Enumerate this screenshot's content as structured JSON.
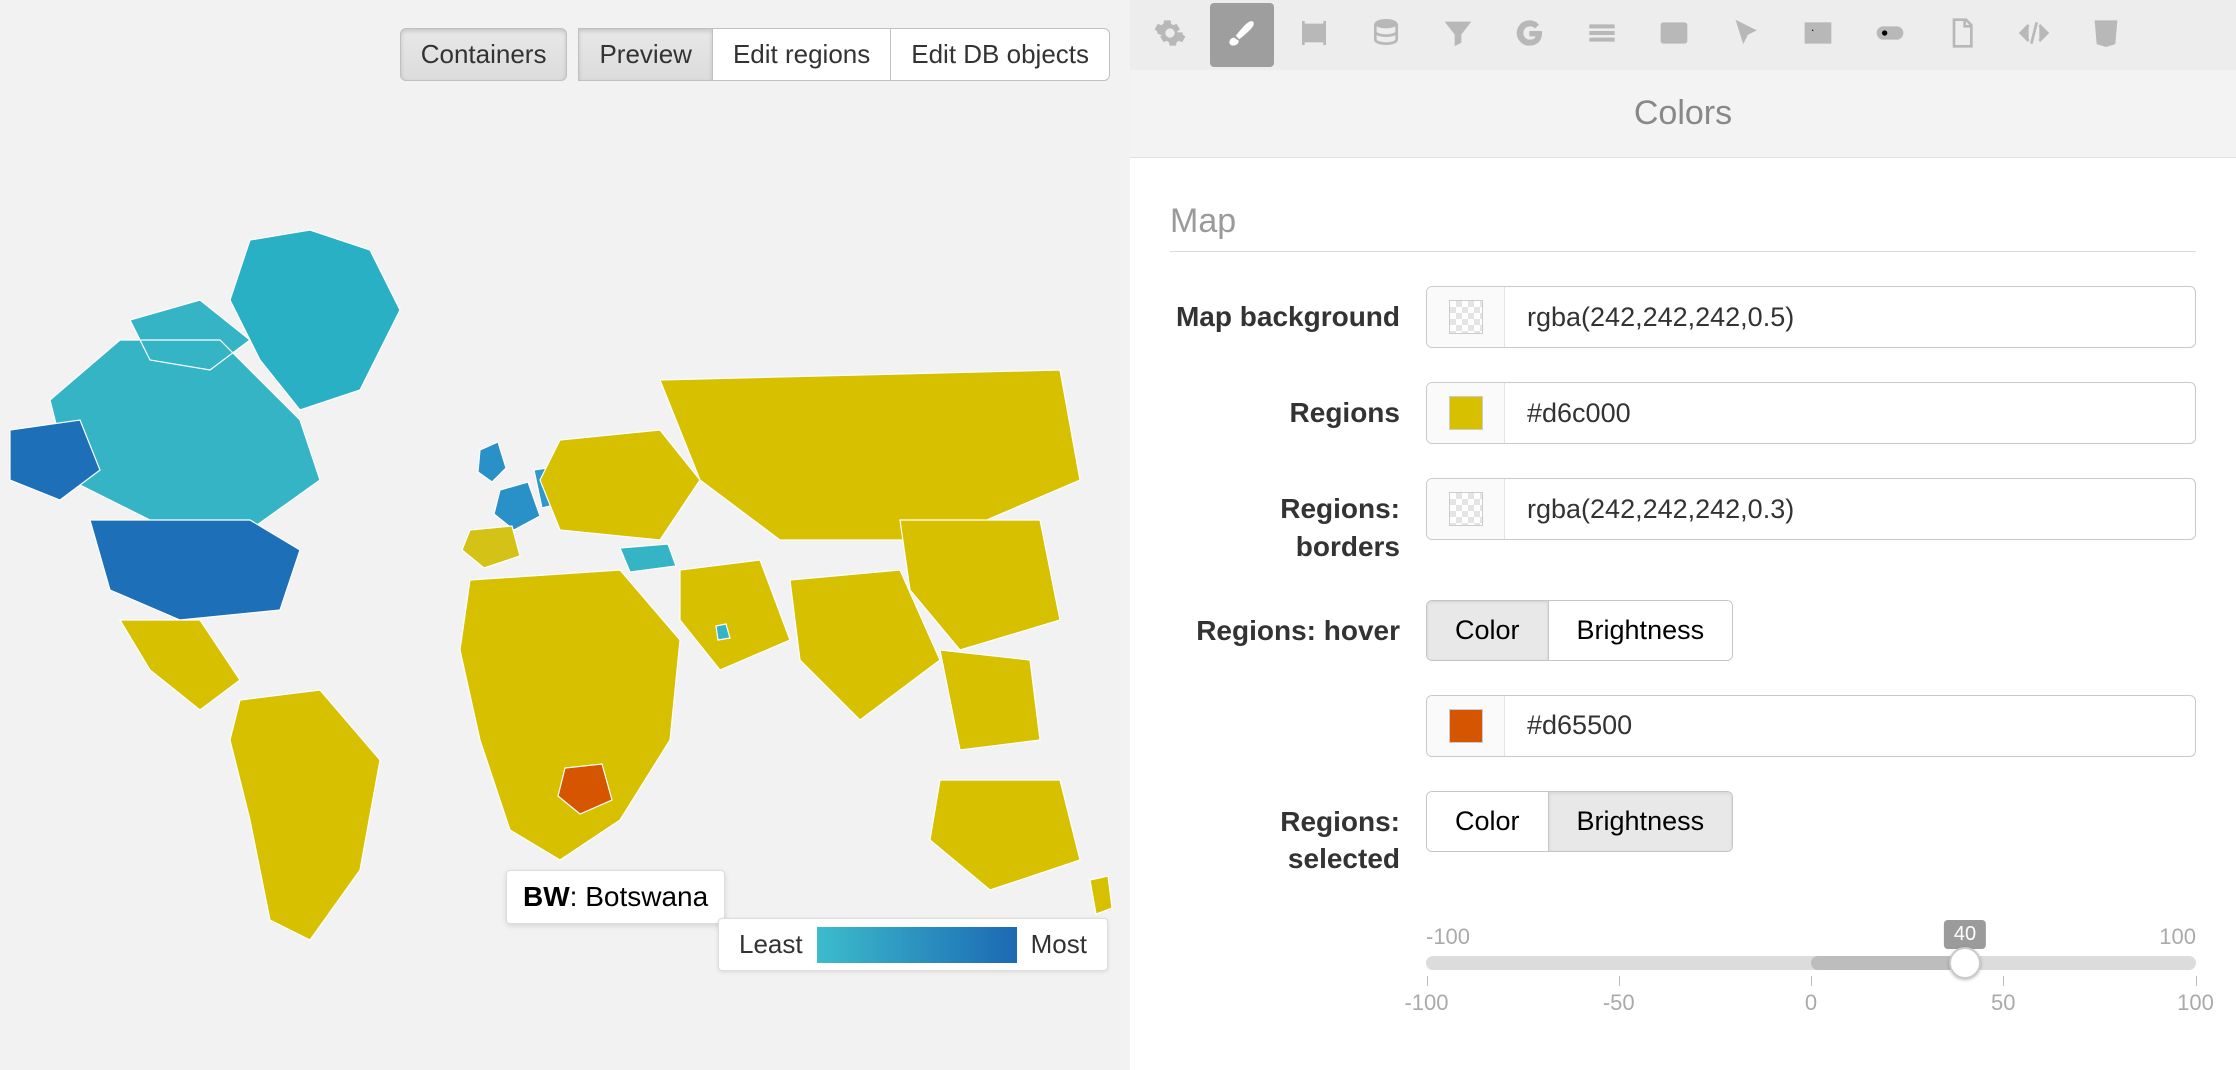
{
  "left": {
    "buttons": {
      "containers": "Containers",
      "preview": "Preview",
      "edit_regions": "Edit regions",
      "edit_db": "Edit DB objects"
    },
    "tooltip_code": "BW",
    "tooltip_name": "Botswana",
    "legend_min": "Least",
    "legend_max": "Most"
  },
  "panel": {
    "title": "Colors",
    "section": "Map",
    "rows": {
      "map_bg": {
        "label": "Map background",
        "value": "rgba(242,242,242,0.5)",
        "swatch": "rgba(242,242,242,0.5)"
      },
      "regions": {
        "label": "Regions",
        "value": "#d6c000",
        "swatch": "#d6c000"
      },
      "borders": {
        "label": "Regions: borders",
        "value": "rgba(242,242,242,0.3)",
        "swatch": "rgba(242,242,242,0.3)"
      },
      "hover": {
        "label": "Regions: hover",
        "opt_color": "Color",
        "opt_bright": "Brightness",
        "value": "#d65500",
        "swatch": "#d65500"
      },
      "selected": {
        "label": "Regions: selected",
        "opt_color": "Color",
        "opt_bright": "Brightness"
      }
    },
    "slider": {
      "min": "-100",
      "max": "100",
      "value": "40",
      "ticks": [
        "-100",
        "-50",
        "0",
        "50",
        "100"
      ]
    }
  },
  "map_colors": {
    "base": "#d6c000",
    "border": "#ffffff",
    "usa": "#1d70b8",
    "canada": "#35b4c6",
    "greenland": "#2ab0c4",
    "mexico": "#d6c000",
    "uk": "#2a90c8",
    "france": "#2a90c8",
    "germany": "#2f98cd",
    "spain": "#d4c216",
    "turkey": "#35b4c6",
    "botswana": "#d65500"
  }
}
